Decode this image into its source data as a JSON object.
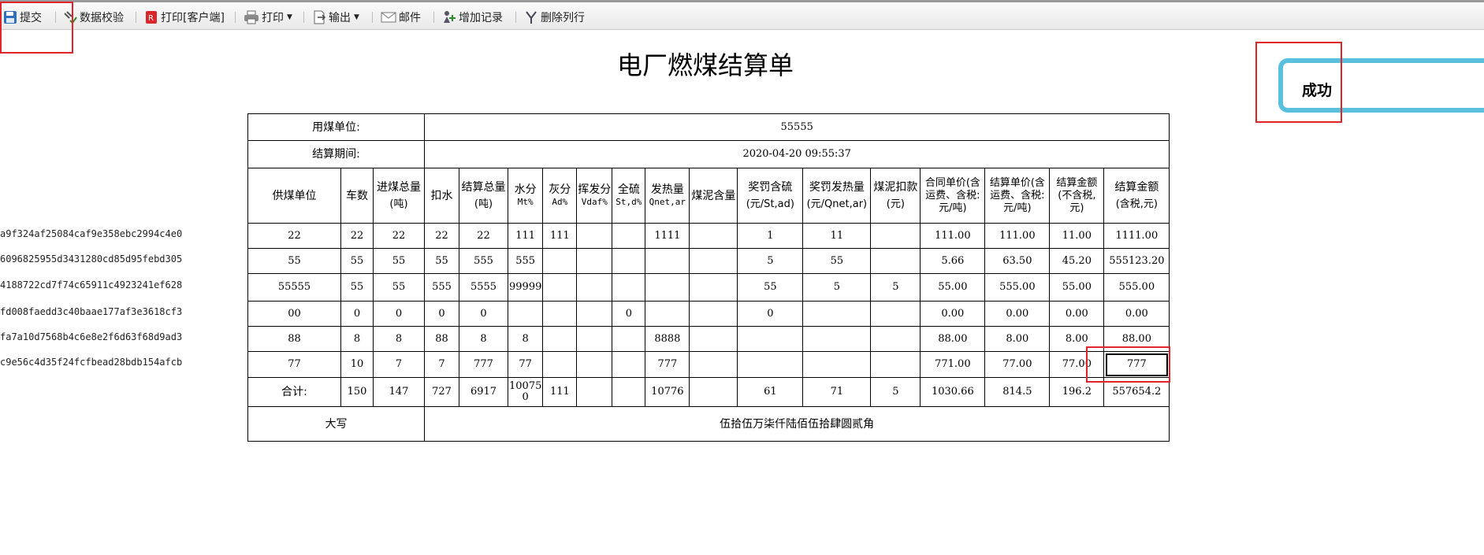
{
  "toolbar": {
    "items": [
      {
        "label": "提交",
        "icon": "save-icon"
      },
      {
        "label": "数据校验",
        "icon": "check-icon"
      },
      {
        "label": "打印[客户端]",
        "icon": "pdf-icon"
      },
      {
        "label": "打印",
        "icon": "printer-icon",
        "dropdown": true
      },
      {
        "label": "输出",
        "icon": "export-icon",
        "dropdown": true
      },
      {
        "label": "邮件",
        "icon": "mail-icon"
      },
      {
        "label": "增加记录",
        "icon": "add-record-icon"
      },
      {
        "label": "删除列行",
        "icon": "delete-row-icon"
      }
    ]
  },
  "toast": {
    "message": "成功"
  },
  "report": {
    "title": "电厂燃煤结算单",
    "coal_unit_label": "用煤单位:",
    "coal_unit_value": "55555",
    "period_label": "结算期间:",
    "period_value": "2020-04-20 09:55:37",
    "headers": {
      "supplier": "供煤单位",
      "cars": "车数",
      "in_total": "进煤总量",
      "in_total_unit": "(吨)",
      "deduct_water": "扣水",
      "settle_total": "结算总量",
      "settle_total_unit": "(吨)",
      "moisture": "水分",
      "moisture_unit": "Mt%",
      "ash": "灰分",
      "ash_unit": "Ad%",
      "volatile": "挥发分",
      "volatile_unit": "Vdaf%",
      "sulfur": "全硫",
      "sulfur_unit": "St,d%",
      "heat": "发热量",
      "heat_unit": "Qnet,ar",
      "slime": "煤泥含量",
      "sulfur_penalty": "奖罚含硫",
      "sulfur_penalty_unit": "(元/St,ad)",
      "heat_penalty": "奖罚发热量",
      "heat_penalty_unit": "(元/Qnet,ar)",
      "slime_deduct": "煤泥扣款",
      "slime_deduct_unit": "(元)",
      "contract_price": "合同单价(含运费、含税:元/吨)",
      "settle_price": "结算单价(含运费、含税:元/吨)",
      "amount_ex_tax": "结算金额(不含税,元)",
      "amount_inc_tax": "结算金额",
      "amount_inc_tax_unit": "(含税,元)"
    },
    "row_ids": [
      "a9f324af25084caf9e358ebc2994c4e0",
      "6096825955d3431280cd85d95febd305",
      "4188722cd7f74c65911c4923241ef628",
      "fd008faedd3c40baae177af3e3618cf3",
      "fa7a10d7568b4c6e8e2f6d63f68d9ad3",
      "c9e56c4d35f24fcfbead28bdb154afcb"
    ],
    "rows": [
      [
        "22",
        "22",
        "22",
        "22",
        "22",
        "111",
        "111",
        "",
        "",
        "1111",
        "",
        "1",
        "11",
        "",
        "111.00",
        "111.00",
        "11.00",
        "1111.00"
      ],
      [
        "55",
        "55",
        "55",
        "55",
        "555",
        "555",
        "",
        "",
        "",
        "",
        "",
        "5",
        "55",
        "",
        "5.66",
        "63.50",
        "45.20",
        "555123.20"
      ],
      [
        "55555",
        "55",
        "55",
        "555",
        "5555",
        "99999",
        "",
        "",
        "",
        "",
        "",
        "55",
        "5",
        "5",
        "55.00",
        "555.00",
        "55.00",
        "555.00"
      ],
      [
        "00",
        "0",
        "0",
        "0",
        "0",
        "",
        "",
        "",
        "0",
        "",
        "",
        "0",
        "",
        "",
        "0.00",
        "0.00",
        "0.00",
        "0.00"
      ],
      [
        "88",
        "8",
        "8",
        "88",
        "8",
        "8",
        "",
        "",
        "",
        "8888",
        "",
        "",
        "",
        "",
        "88.00",
        "8.00",
        "8.00",
        "88.00"
      ],
      [
        "77",
        "10",
        "7",
        "7",
        "777",
        "77",
        "",
        "",
        "",
        "777",
        "",
        "",
        "",
        "",
        "771.00",
        "77.00",
        "77.00",
        "777"
      ]
    ],
    "totals": [
      "合计:",
      "150",
      "147",
      "727",
      "6917",
      "100750",
      "111",
      "",
      "",
      "10776",
      "",
      "61",
      "71",
      "5",
      "1030.66",
      "814.5",
      "196.2",
      "557654.2"
    ],
    "uppercase_label": "大写",
    "uppercase_value": "伍拾伍万柒仟陆佰伍拾肆圆贰角"
  }
}
